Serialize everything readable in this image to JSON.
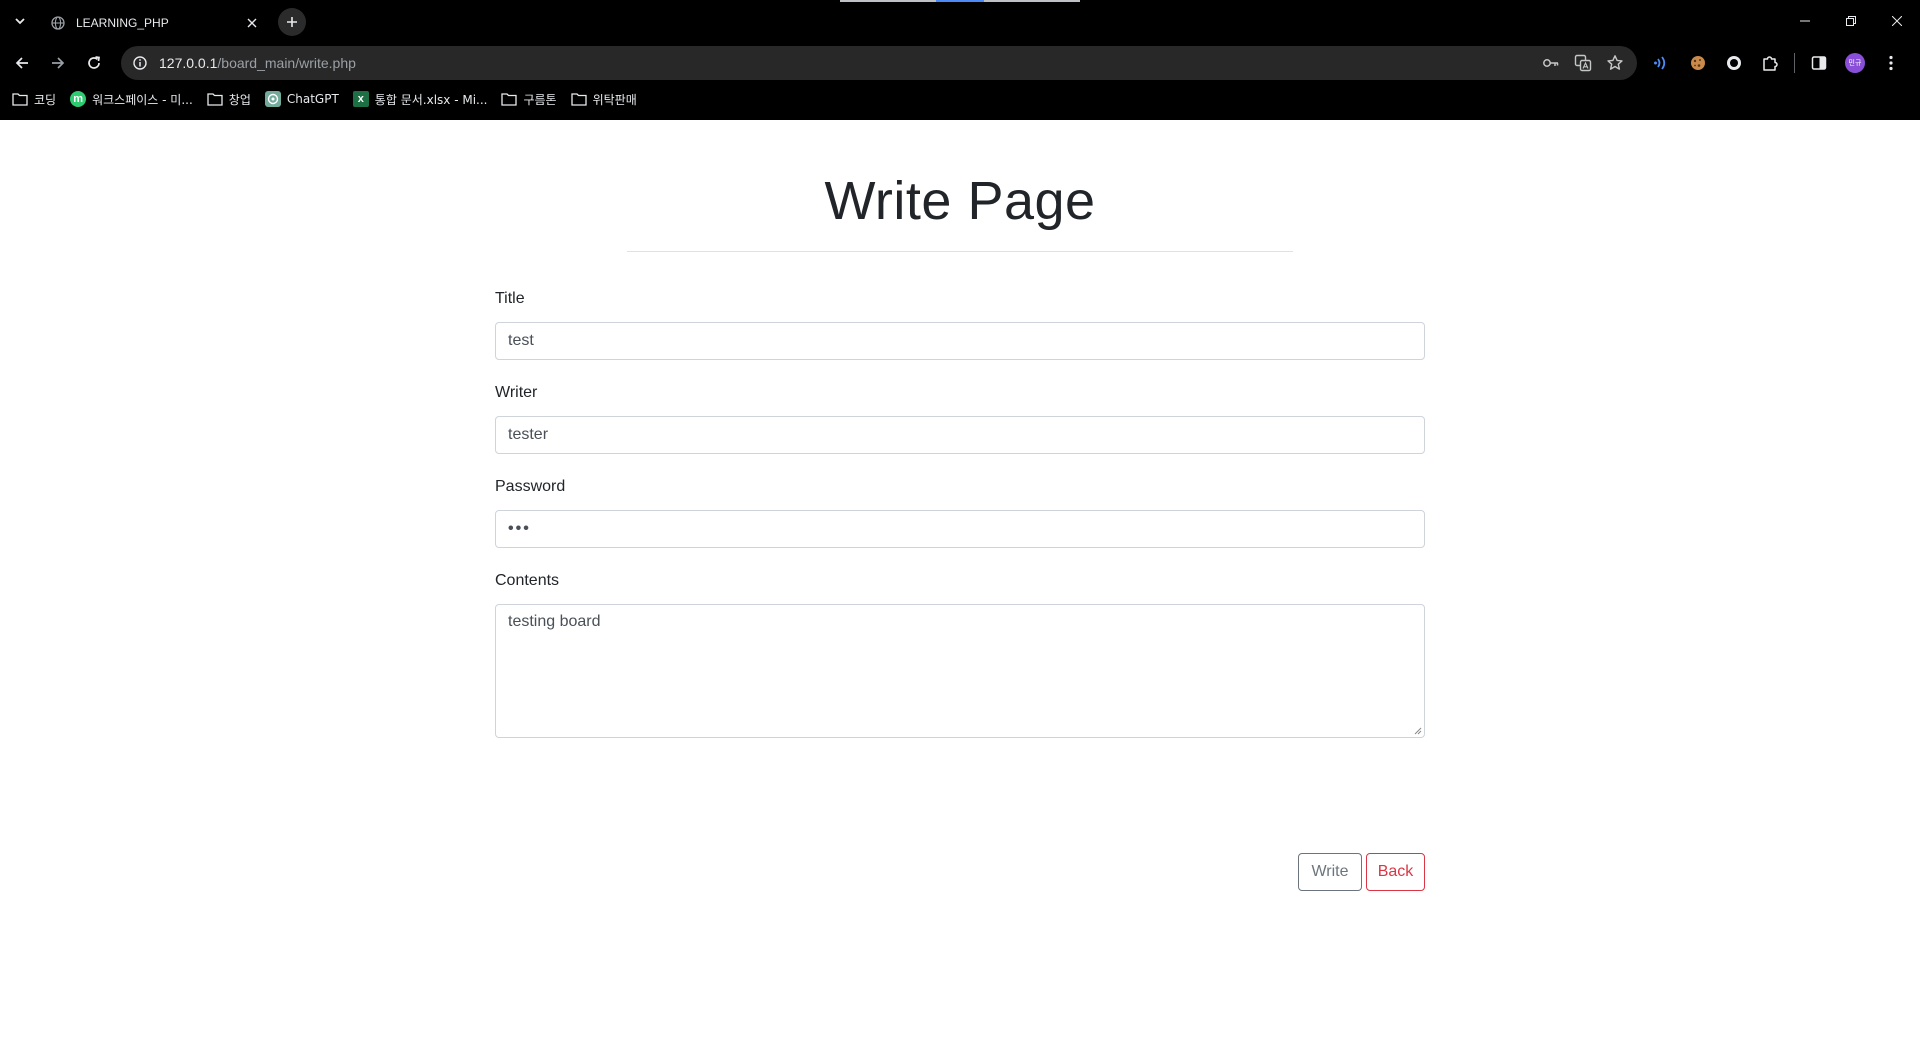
{
  "browser": {
    "tab": {
      "title": "LEARNING_PHP"
    },
    "url": {
      "host": "127.0.0.1",
      "path": "/board_main/write.php"
    },
    "avatar_text": "민규",
    "bookmarks": [
      {
        "label": "코딩",
        "icon": "folder-icon"
      },
      {
        "label": "워크스페이스 - 미...",
        "icon": "workspace-logo-icon"
      },
      {
        "label": "창업",
        "icon": "folder-icon"
      },
      {
        "label": "ChatGPT",
        "icon": "chatgpt-icon"
      },
      {
        "label": "통합 문서.xlsx - Mi...",
        "icon": "excel-icon"
      },
      {
        "label": "구름톤",
        "icon": "folder-icon"
      },
      {
        "label": "위탁판매",
        "icon": "folder-icon"
      }
    ],
    "icon_letters": {
      "workspace": "m",
      "excel": "x"
    }
  },
  "page": {
    "heading": "Write Page",
    "form": {
      "title": {
        "label": "Title",
        "value": "test"
      },
      "writer": {
        "label": "Writer",
        "value": "tester"
      },
      "password": {
        "label": "Password",
        "value": "•••"
      },
      "contents": {
        "label": "Contents",
        "value": "testing board"
      }
    },
    "buttons": {
      "write": "Write",
      "back": "Back"
    }
  },
  "colors": {
    "chrome_bg": "#000000",
    "omnibox_bg": "#282828",
    "secondary_btn": "#6c757d",
    "danger_btn": "#dc3545"
  }
}
